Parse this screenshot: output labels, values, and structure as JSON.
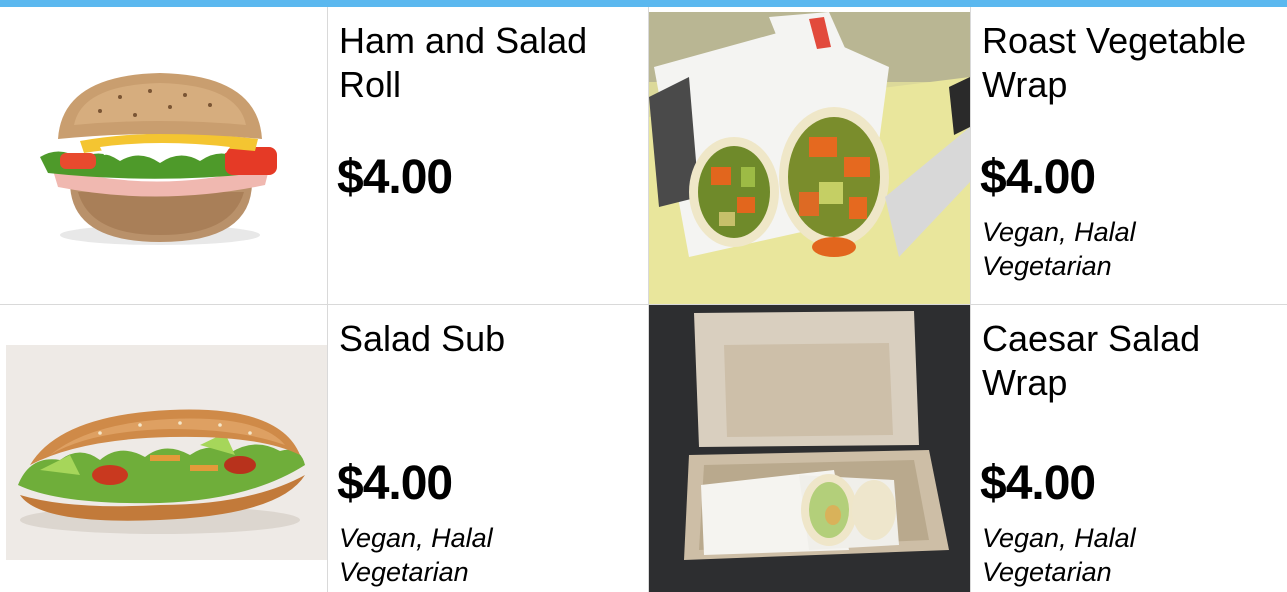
{
  "colors": {
    "accent_bar": "#5bb8ef",
    "divider": "#d9d9d9"
  },
  "menu": {
    "items": [
      {
        "name": "Ham and Salad Roll",
        "price": "$4.00",
        "tags": "",
        "image_icon": "sandwich-roll-icon"
      },
      {
        "name": "Roast Vegetable Wrap",
        "price": "$4.00",
        "tags": "Vegan, Halal Vegetarian",
        "image_icon": "vegetable-wrap-icon"
      },
      {
        "name": "Salad Sub",
        "price": "$4.00",
        "tags": "Vegan, Halal Vegetarian",
        "image_icon": "salad-sub-icon"
      },
      {
        "name": "Caesar Salad Wrap",
        "price": "$4.00",
        "tags": "Vegan, Halal Vegetarian",
        "image_icon": "boxed-wrap-icon"
      }
    ]
  }
}
